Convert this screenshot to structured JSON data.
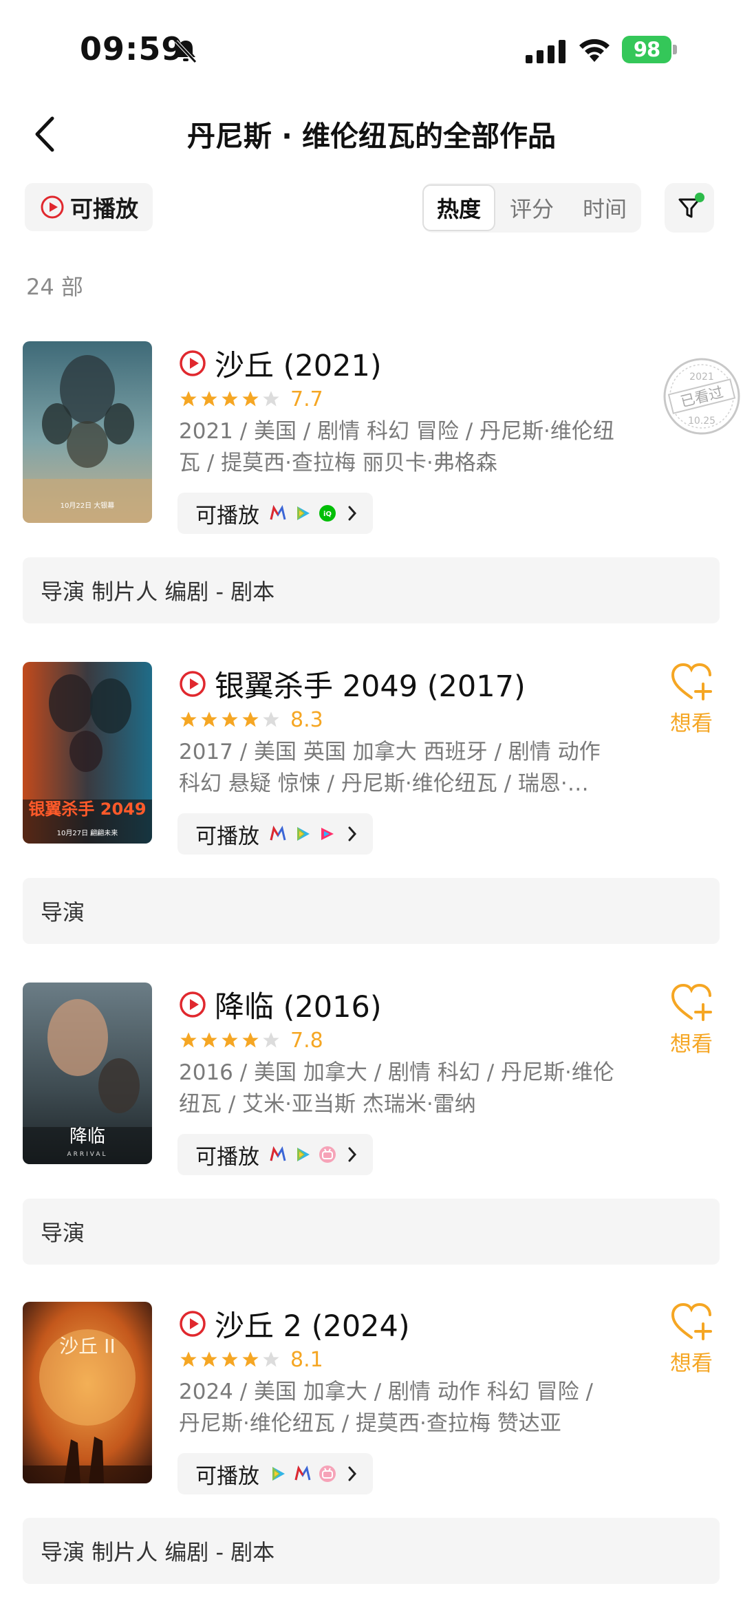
{
  "status_bar": {
    "time": "09:59",
    "battery": "98"
  },
  "nav": {
    "title": "丹尼斯 · 维伦纽瓦的全部作品"
  },
  "toolbar": {
    "playable_label": "可播放",
    "sort_tabs": [
      "热度",
      "评分",
      "时间"
    ],
    "active_sort": "热度"
  },
  "count_label": "24 部",
  "movies": [
    {
      "title": "沙丘 (2021)",
      "stars": 4,
      "score": "7.7",
      "meta": "2021 / 美国 / 剧情 科幻 冒险 / 丹尼斯·维伦纽瓦 / 提莫西·查拉梅 丽贝卡·弗格森",
      "play_label": "可播放",
      "sources": [
        "migu-icon",
        "tencent-video-icon",
        "iqiyi-icon"
      ],
      "roles": "导演 制片人 编剧 - 剧本",
      "watched_stamp": {
        "year": "2021",
        "label": "已看过",
        "date": "10.25"
      }
    },
    {
      "title": "银翼杀手 2049 (2017)",
      "stars": 4,
      "score": "8.3",
      "meta": "2017 / 美国 英国 加拿大 西班牙 / 剧情 动作 科幻 悬疑 惊悚 / 丹尼斯·维伦纽瓦 / 瑞恩·…",
      "play_label": "可播放",
      "sources": [
        "migu-icon",
        "tencent-video-icon",
        "youku-icon"
      ],
      "roles": "导演",
      "want_label": "想看"
    },
    {
      "title": "降临 (2016)",
      "stars": 4,
      "score": "7.8",
      "meta": "2016 / 美国 加拿大 / 剧情 科幻 / 丹尼斯·维伦纽瓦 / 艾米·亚当斯 杰瑞米·雷纳",
      "play_label": "可播放",
      "sources": [
        "migu-icon",
        "tencent-video-icon",
        "bilibili-icon"
      ],
      "roles": "导演",
      "want_label": "想看"
    },
    {
      "title": "沙丘 2 (2024)",
      "stars": 4,
      "score": "8.1",
      "meta": "2024 / 美国 加拿大 / 剧情 动作 科幻 冒险 / 丹尼斯·维伦纽瓦 / 提莫西·查拉梅 赞达亚",
      "play_label": "可播放",
      "sources": [
        "tencent-video-icon",
        "migu-icon",
        "bilibili-icon"
      ],
      "roles": "导演 制片人 编剧 - 剧本",
      "want_label": "想看"
    }
  ],
  "posters": [
    {
      "caption": "10月22日 大银幕"
    },
    {
      "caption": "银翼杀手 2049",
      "date": "10月27日 翩翩未来"
    },
    {
      "caption": "降临",
      "sub": "ARRIVAL"
    },
    {
      "caption": "沙丘 II"
    }
  ],
  "colors": {
    "accent_orange": "#f5a623",
    "play_red": "#e0282e",
    "green": "#34c759"
  }
}
